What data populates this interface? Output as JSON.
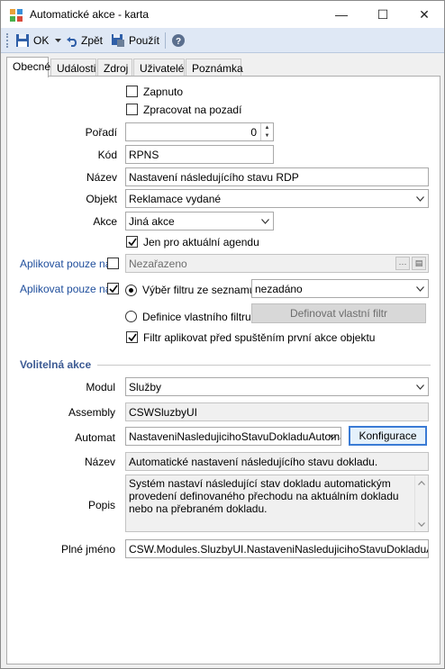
{
  "window": {
    "title": "Automatické akce - karta",
    "minimize_glyph": "—",
    "maximize_glyph": "☐",
    "close_glyph": "✕"
  },
  "toolbar": {
    "ok_label": "OK",
    "back_label": "Zpět",
    "apply_label": "Použít"
  },
  "tabs": [
    "Obecné",
    "Události",
    "Zdroj",
    "Uživatelé",
    "Poznámka"
  ],
  "form": {
    "enabled_label": "Zapnuto",
    "background_label": "Zpracovat na pozadí",
    "order_label": "Pořadí",
    "order_value": "0",
    "code_label": "Kód",
    "code_value": "RPNS",
    "name_label": "Název",
    "name_value": "Nastavení následujícího stavu RDP",
    "object_label": "Objekt",
    "object_value": "Reklamace vydané",
    "action_label": "Akce",
    "action_value": "Jiná akce",
    "current_agenda_label": "Jen pro aktuální agendu",
    "apply_only_label_1": "Aplikovat pouze na",
    "apply_only_value_1": "Nezařazeno",
    "apply_only_label_2": "Aplikovat pouze na",
    "filter_from_list_label": "Výběr filtru ze seznamu",
    "filter_value": "nezadáno",
    "custom_filter_label": "Definice vlastního filtru",
    "define_filter_button": "Definovat vlastní filtr",
    "apply_filter_before_label": "Filtr aplikovat před spuštěním první akce objektu"
  },
  "optional": {
    "section_title": "Volitelná akce",
    "module_label": "Modul",
    "module_value": "Služby",
    "assembly_label": "Assembly",
    "assembly_value": "CSWSluzbyUI",
    "automat_label": "Automat",
    "automat_value": "NastaveniNasledujicihoStavuDokladuAutomat",
    "config_button": "Konfigurace",
    "name_label": "Název",
    "name_value": "Automatické nastavení následujícího stavu dokladu.",
    "description_label": "Popis",
    "description_value": "Systém nastaví následující stav dokladu automatickým provedení definovaného přechodu na aktuálním dokladu nebo na přebraném dokladu.",
    "fullname_label": "Plné jméno",
    "fullname_value": "CSW.Modules.SluzbyUI.NastaveniNasledujicihoStavuDokladuAutomat"
  },
  "icons": {
    "app": "app-puzzle-icon",
    "save": "floppy-save-icon",
    "dropdown": "chevron-down-icon",
    "undo": "undo-arrow-icon",
    "apply": "floppy-apply-icon",
    "help": "help-icon"
  },
  "state": {
    "enabled": false,
    "background": false,
    "current_agenda": true,
    "apply_only_1": false,
    "apply_only_2": true,
    "filter_mode": "list",
    "apply_filter_before": true,
    "active_tab": "Obecné"
  },
  "colors": {
    "link_label": "#1f4e9c",
    "section_title": "#3c5a93",
    "toolbar_bg": "#dfe8f5"
  }
}
